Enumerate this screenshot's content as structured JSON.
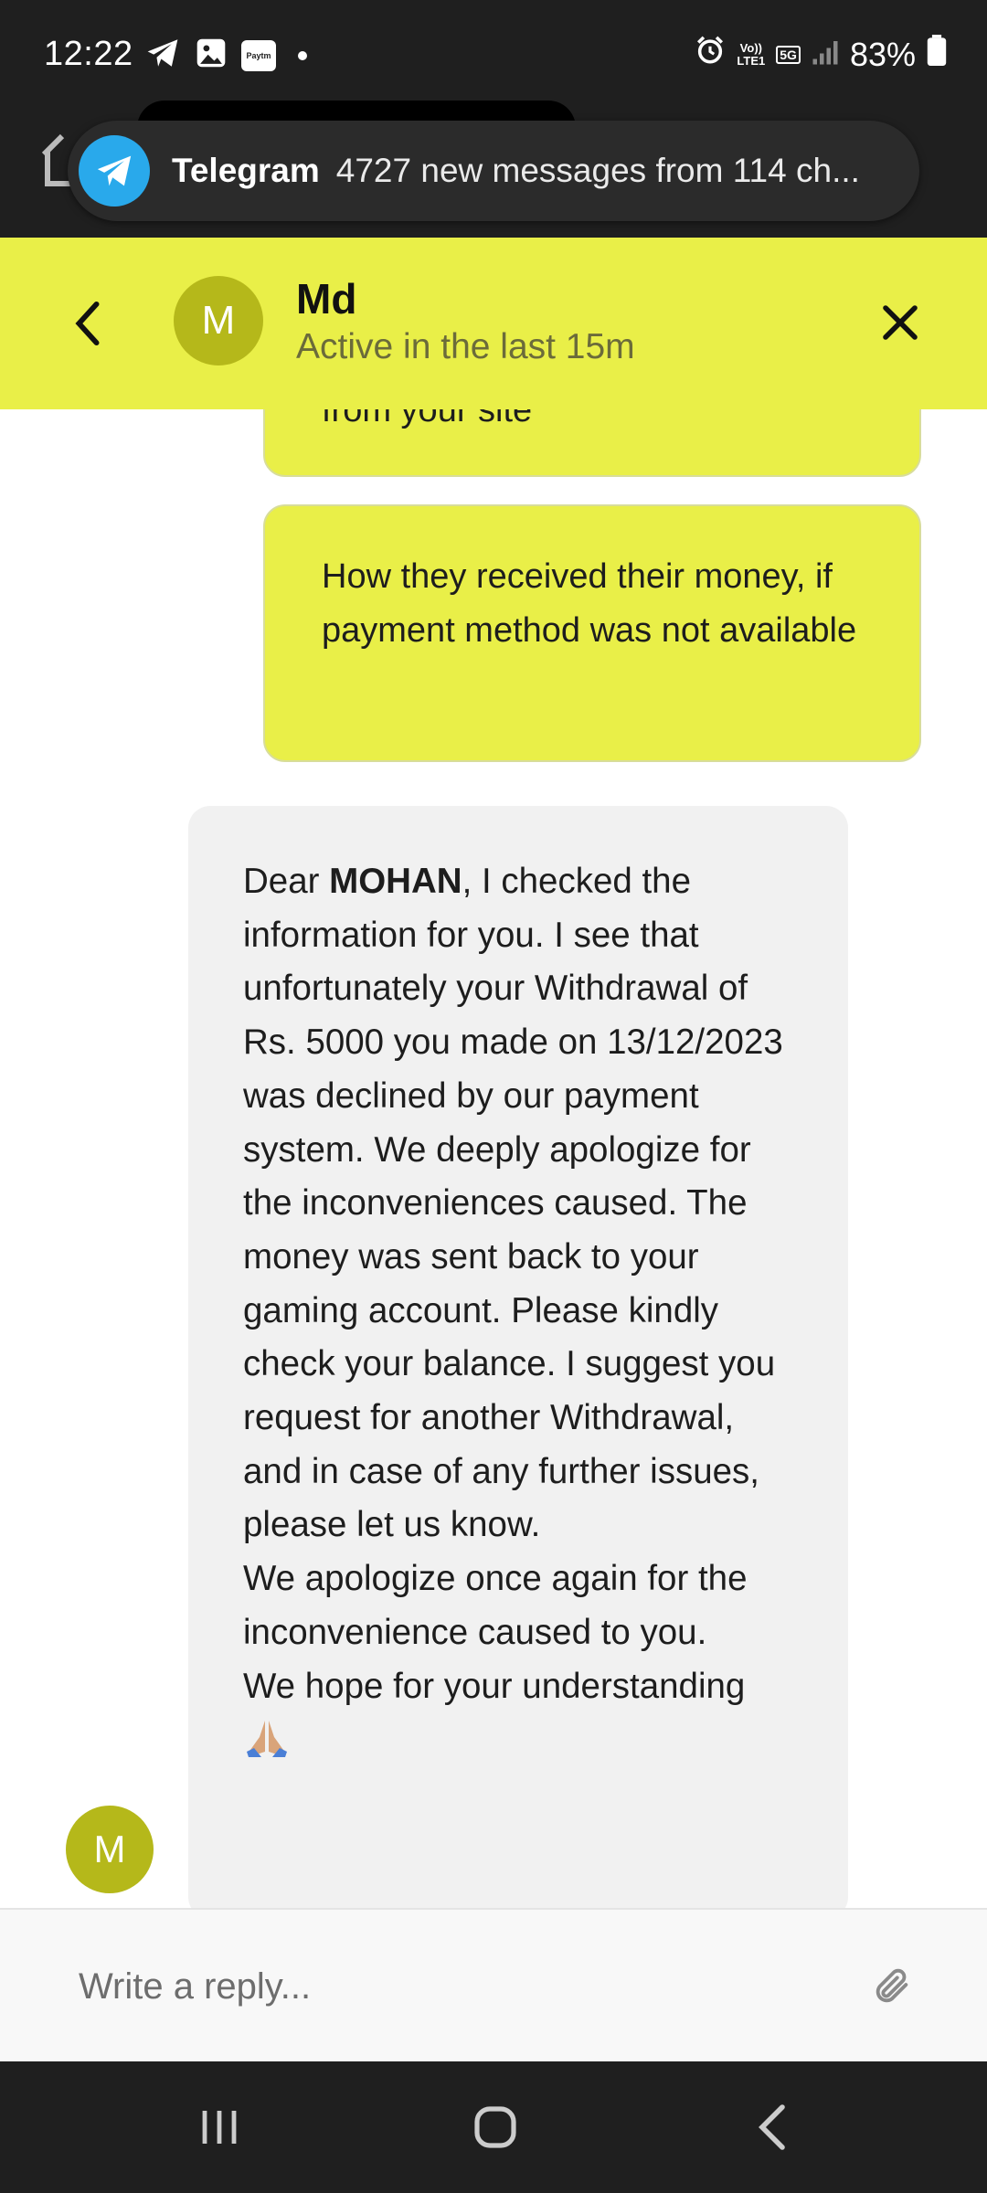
{
  "status_bar": {
    "time": "12:22",
    "paytm_label": "Paytm",
    "lte_label_top": "Vo))",
    "lte_label_bottom": "LTE1",
    "network_label": "5G",
    "battery_percent": "83%"
  },
  "notification": {
    "app_name": "Telegram",
    "message": "4727 new messages from 114 ch..."
  },
  "chat_header": {
    "avatar_initial": "M",
    "contact_name": "Md",
    "status": "Active in the last 15m"
  },
  "messages": {
    "outgoing_partial": "from your site",
    "outgoing": "How they received their money, if payment method was not available",
    "incoming_greeting": "Dear ",
    "incoming_name": "MOHAN",
    "incoming_body": ", I checked the information for you. I see that unfortunately your Withdrawal of Rs. 5000 you made on 13/12/2023 was declined by our payment system. We deeply apologize for the inconveniences caused. The money was sent back to your gaming account. Please kindly check your balance. I suggest you request for another Withdrawal, and in case of any further issues, please let us know.\nWe apologize once again for the inconvenience caused to you.\nWe hope for your understanding",
    "incoming_avatar_initial": "M",
    "emoji_icon": "folded-hands-icon"
  },
  "composer": {
    "placeholder": "Write a reply..."
  },
  "colors": {
    "accent": "#e9ef48",
    "avatar": "#b5b81a",
    "incoming_bubble": "#f1f1f1",
    "system_bar": "#1f1f1f",
    "telegram": "#29a9eb"
  }
}
